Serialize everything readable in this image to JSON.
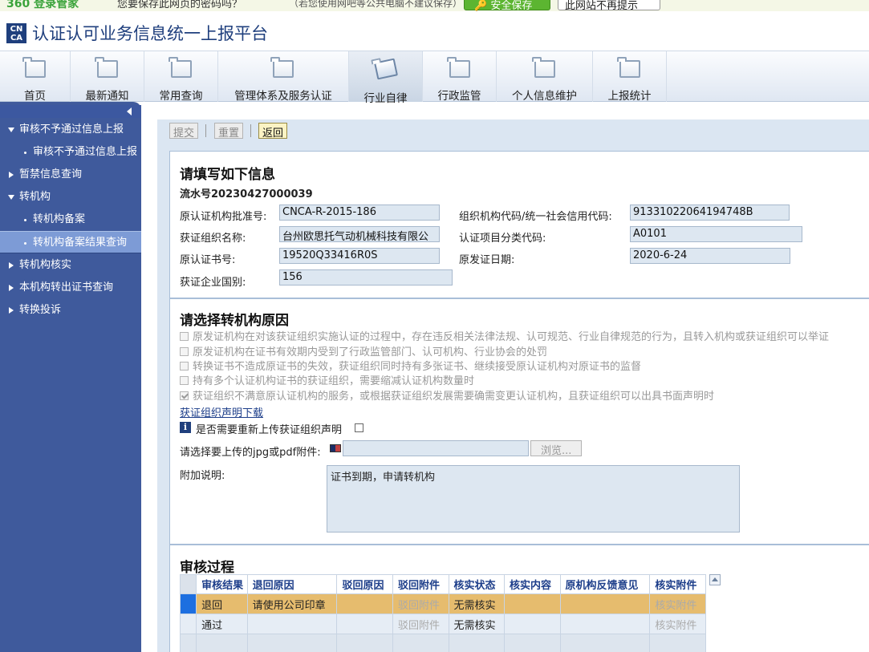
{
  "password_bar": {
    "logo": "360 登录管家",
    "message": "您要保存此网页的密码吗？",
    "sub": "（若您使用网吧等公共电脑不建议保存）",
    "save_button": "安全保存",
    "never_button": "此网站不再提示"
  },
  "app": {
    "logo_text": "CN CA",
    "title": "认证认可业务信息统一上报平台"
  },
  "nav": {
    "items": [
      {
        "label": "首页"
      },
      {
        "label": "最新通知"
      },
      {
        "label": "常用查询"
      },
      {
        "label": "管理体系及服务认证"
      },
      {
        "label": "行业自律"
      },
      {
        "label": "行政监管"
      },
      {
        "label": "个人信息维护"
      },
      {
        "label": "上报统计"
      }
    ],
    "active": "行业自律"
  },
  "sidebar": {
    "items": [
      {
        "label": "审核不予通过信息上报"
      },
      {
        "label": "审核不予通过信息上报"
      },
      {
        "label": "暂禁信息查询"
      },
      {
        "label": "转机构"
      },
      {
        "label": "转机构备案"
      },
      {
        "label": "转机构备案结果查询"
      },
      {
        "label": "转机构核实"
      },
      {
        "label": "本机构转出证书查询"
      },
      {
        "label": "转换投诉"
      }
    ]
  },
  "toolbar": {
    "submit": "提交",
    "reset": "重置",
    "back": "返回"
  },
  "form": {
    "heading": "请填写如下信息",
    "serial": "流水号20230427000039",
    "fields": {
      "orig_approval_label": "原认证机构批准号:",
      "orig_approval_value": "CNCA-R-2015-186",
      "org_code_label": "组织机构代码/统一社会信用代码:",
      "org_code_value": "91331022064194748B",
      "org_name_label": "获证组织名称:",
      "org_name_value": "台州欧思托气动机械科技有限公",
      "category_label": "认证项目分类代码:",
      "category_value": "A0101",
      "cert_no_label": "原认证书号:",
      "cert_no_value": "19520Q33416R0S",
      "issue_date_label": "原发证日期:",
      "issue_date_value": "2020-6-24",
      "country_label": "获证企业国别:",
      "country_value": "156"
    }
  },
  "reasons": {
    "heading": "请选择转机构原因",
    "items": [
      {
        "text": "原发证机构在对该获证组织实施认证的过程中，存在违反相关法律法规、认可规范、行业自律规范的行为，且转入机构或获证组织可以举证",
        "checked": false
      },
      {
        "text": "原发证机构在证书有效期内受到了行政监管部门、认可机构、行业协会的处罚",
        "checked": false
      },
      {
        "text": "转换证书不造成原证书的失效，获证组织同时持有多张证书、继续接受原认证机构对原证书的监督",
        "checked": false
      },
      {
        "text": "持有多个认证机构证书的获证组织，需要缩减认证机构数量时",
        "checked": false
      },
      {
        "text": "获证组织不满意原认证机构的服务，或根据获证组织发展需要确需变更认证机构，且获证组织可以出具书面声明时",
        "checked": true
      }
    ],
    "download_link": "获证组织声明下载",
    "reupload_label": "是否需要重新上传获证组织声明",
    "file_label": "请选择要上传的jpg或pdf附件:",
    "browse": "浏览...",
    "note_label": "附加说明:",
    "note_value": "证书到期，申请转机构"
  },
  "review": {
    "heading": "审核过程",
    "columns": [
      "审核结果",
      "退回原因",
      "驳回原因",
      "驳回附件",
      "核实状态",
      "核实内容",
      "原机构反馈意见",
      "核实附件"
    ],
    "rows": [
      [
        "退回",
        "请使用公司印章",
        "",
        "驳回附件",
        "无需核实",
        "",
        "",
        "核实附件"
      ],
      [
        "通过",
        "",
        "",
        "驳回附件",
        "无需核实",
        "",
        "",
        "核实附件"
      ],
      [
        "",
        "",
        "",
        "",
        "",
        "",
        "",
        ""
      ]
    ]
  }
}
